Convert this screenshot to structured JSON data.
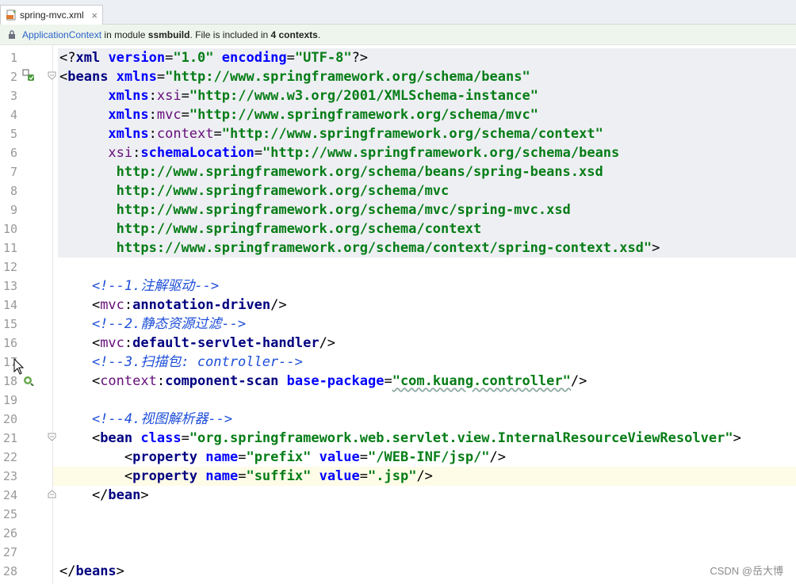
{
  "tab": {
    "title": "spring-mvc.xml",
    "close": "×",
    "icon": "xml-file-icon"
  },
  "infobar": {
    "link": "ApplicationContext",
    "text1": " in module ",
    "module": "ssmbuild",
    "text2": ". File is included in ",
    "count": "4 contexts",
    "text3": "."
  },
  "lines": [
    {
      "n": "1",
      "tokens": [
        [
          "p",
          "<?"
        ],
        [
          "t",
          "xml "
        ],
        [
          "a",
          "version"
        ],
        [
          "p",
          "="
        ],
        [
          "v",
          "\"1.0\" "
        ],
        [
          "a",
          "encoding"
        ],
        [
          "p",
          "="
        ],
        [
          "v",
          "\"UTF-8\""
        ],
        [
          "p",
          "?>"
        ]
      ]
    },
    {
      "n": "2",
      "tokens": [
        [
          "p",
          "<"
        ],
        [
          "t",
          "beans "
        ],
        [
          "a",
          "xmlns"
        ],
        [
          "p",
          "="
        ],
        [
          "v",
          "\"http://www.springframework.org/schema/beans\""
        ]
      ]
    },
    {
      "n": "3",
      "tokens": [
        [
          "p",
          "      "
        ],
        [
          "a",
          "xmlns"
        ],
        [
          "p",
          ":"
        ],
        [
          "ns",
          "xsi"
        ],
        [
          "p",
          "="
        ],
        [
          "v",
          "\"http://www.w3.org/2001/XMLSchema-instance\""
        ]
      ]
    },
    {
      "n": "4",
      "tokens": [
        [
          "p",
          "      "
        ],
        [
          "a",
          "xmlns"
        ],
        [
          "p",
          ":"
        ],
        [
          "ns",
          "mvc"
        ],
        [
          "p",
          "="
        ],
        [
          "v",
          "\"http://www.springframework.org/schema/mvc\""
        ]
      ]
    },
    {
      "n": "5",
      "tokens": [
        [
          "p",
          "      "
        ],
        [
          "a",
          "xmlns"
        ],
        [
          "p",
          ":"
        ],
        [
          "ns",
          "context"
        ],
        [
          "p",
          "="
        ],
        [
          "v",
          "\"http://www.springframework.org/schema/context\""
        ]
      ]
    },
    {
      "n": "6",
      "tokens": [
        [
          "p",
          "      "
        ],
        [
          "ns",
          "xsi"
        ],
        [
          "p",
          ":"
        ],
        [
          "a",
          "schemaLocation"
        ],
        [
          "p",
          "="
        ],
        [
          "v",
          "\"http://www.springframework.org/schema/beans"
        ]
      ]
    },
    {
      "n": "7",
      "tokens": [
        [
          "v",
          "       http://www.springframework.org/schema/beans/spring-beans.xsd"
        ]
      ]
    },
    {
      "n": "8",
      "tokens": [
        [
          "v",
          "       http://www.springframework.org/schema/mvc"
        ]
      ]
    },
    {
      "n": "9",
      "tokens": [
        [
          "v",
          "       http://www.springframework.org/schema/mvc/spring-mvc.xsd"
        ]
      ]
    },
    {
      "n": "10",
      "tokens": [
        [
          "v",
          "       http://www.springframework.org/schema/context"
        ]
      ]
    },
    {
      "n": "11",
      "tokens": [
        [
          "v",
          "       https://www.springframework.org/schema/context/spring-context.xsd\""
        ],
        [
          "p",
          ">"
        ]
      ]
    },
    {
      "n": "12",
      "tokens": []
    },
    {
      "n": "13",
      "tokens": [
        [
          "c",
          "    <!--1.注解驱动-->"
        ]
      ]
    },
    {
      "n": "14",
      "tokens": [
        [
          "p",
          "    <"
        ],
        [
          "ns",
          "mvc"
        ],
        [
          "p",
          ":"
        ],
        [
          "t",
          "annotation-driven"
        ],
        [
          "p",
          "/>"
        ]
      ]
    },
    {
      "n": "15",
      "tokens": [
        [
          "c",
          "    <!--2.静态资源过滤-->"
        ]
      ]
    },
    {
      "n": "16",
      "tokens": [
        [
          "p",
          "    <"
        ],
        [
          "ns",
          "mvc"
        ],
        [
          "p",
          ":"
        ],
        [
          "t",
          "default-servlet-handler"
        ],
        [
          "p",
          "/>"
        ]
      ]
    },
    {
      "n": "17",
      "tokens": [
        [
          "c",
          "    <!--3.扫描包: controller-->"
        ]
      ]
    },
    {
      "n": "18",
      "tokens": [
        [
          "p",
          "    <"
        ],
        [
          "ns",
          "context"
        ],
        [
          "p",
          ":"
        ],
        [
          "t",
          "component-scan "
        ],
        [
          "a",
          "base-package"
        ],
        [
          "p",
          "="
        ],
        [
          "v",
          "\"com.kuang.controller\""
        ],
        [
          "p",
          "/>"
        ]
      ]
    },
    {
      "n": "19",
      "tokens": []
    },
    {
      "n": "20",
      "tokens": [
        [
          "c",
          "    <!--4.视图解析器-->"
        ]
      ]
    },
    {
      "n": "21",
      "tokens": [
        [
          "p",
          "    <"
        ],
        [
          "t",
          "bean "
        ],
        [
          "a",
          "class"
        ],
        [
          "p",
          "="
        ],
        [
          "v",
          "\"org.springframework.web.servlet.view.InternalResourceViewResolver\""
        ],
        [
          "p",
          ">"
        ]
      ]
    },
    {
      "n": "22",
      "tokens": [
        [
          "p",
          "        <"
        ],
        [
          "t",
          "property "
        ],
        [
          "a",
          "name"
        ],
        [
          "p",
          "="
        ],
        [
          "v",
          "\"prefix\" "
        ],
        [
          "a",
          "value"
        ],
        [
          "p",
          "="
        ],
        [
          "v",
          "\"/WEB-INF/jsp/\""
        ],
        [
          "p",
          "/>"
        ]
      ]
    },
    {
      "n": "23",
      "tokens": [
        [
          "p",
          "        <"
        ],
        [
          "t",
          "property "
        ],
        [
          "a",
          "name"
        ],
        [
          "p",
          "="
        ],
        [
          "v",
          "\"suffix\" "
        ],
        [
          "a",
          "value"
        ],
        [
          "p",
          "="
        ],
        [
          "v",
          "\".jsp\""
        ],
        [
          "p",
          "/>"
        ]
      ]
    },
    {
      "n": "24",
      "tokens": [
        [
          "p",
          "    </"
        ],
        [
          "t",
          "bean"
        ],
        [
          "p",
          ">"
        ]
      ]
    },
    {
      "n": "25",
      "tokens": []
    },
    {
      "n": "26",
      "tokens": []
    },
    {
      "n": "27",
      "tokens": []
    },
    {
      "n": "28",
      "tokens": [
        [
          "p",
          "</"
        ],
        [
          "t",
          "beans"
        ],
        [
          "p",
          ">"
        ]
      ]
    }
  ],
  "watermark": "CSDN @岳大博",
  "colors": {
    "tag": "#000080",
    "attr": "#0000ff",
    "value": "#067d17",
    "namespace": "#660e7a",
    "comment": "#1d4ed8"
  }
}
